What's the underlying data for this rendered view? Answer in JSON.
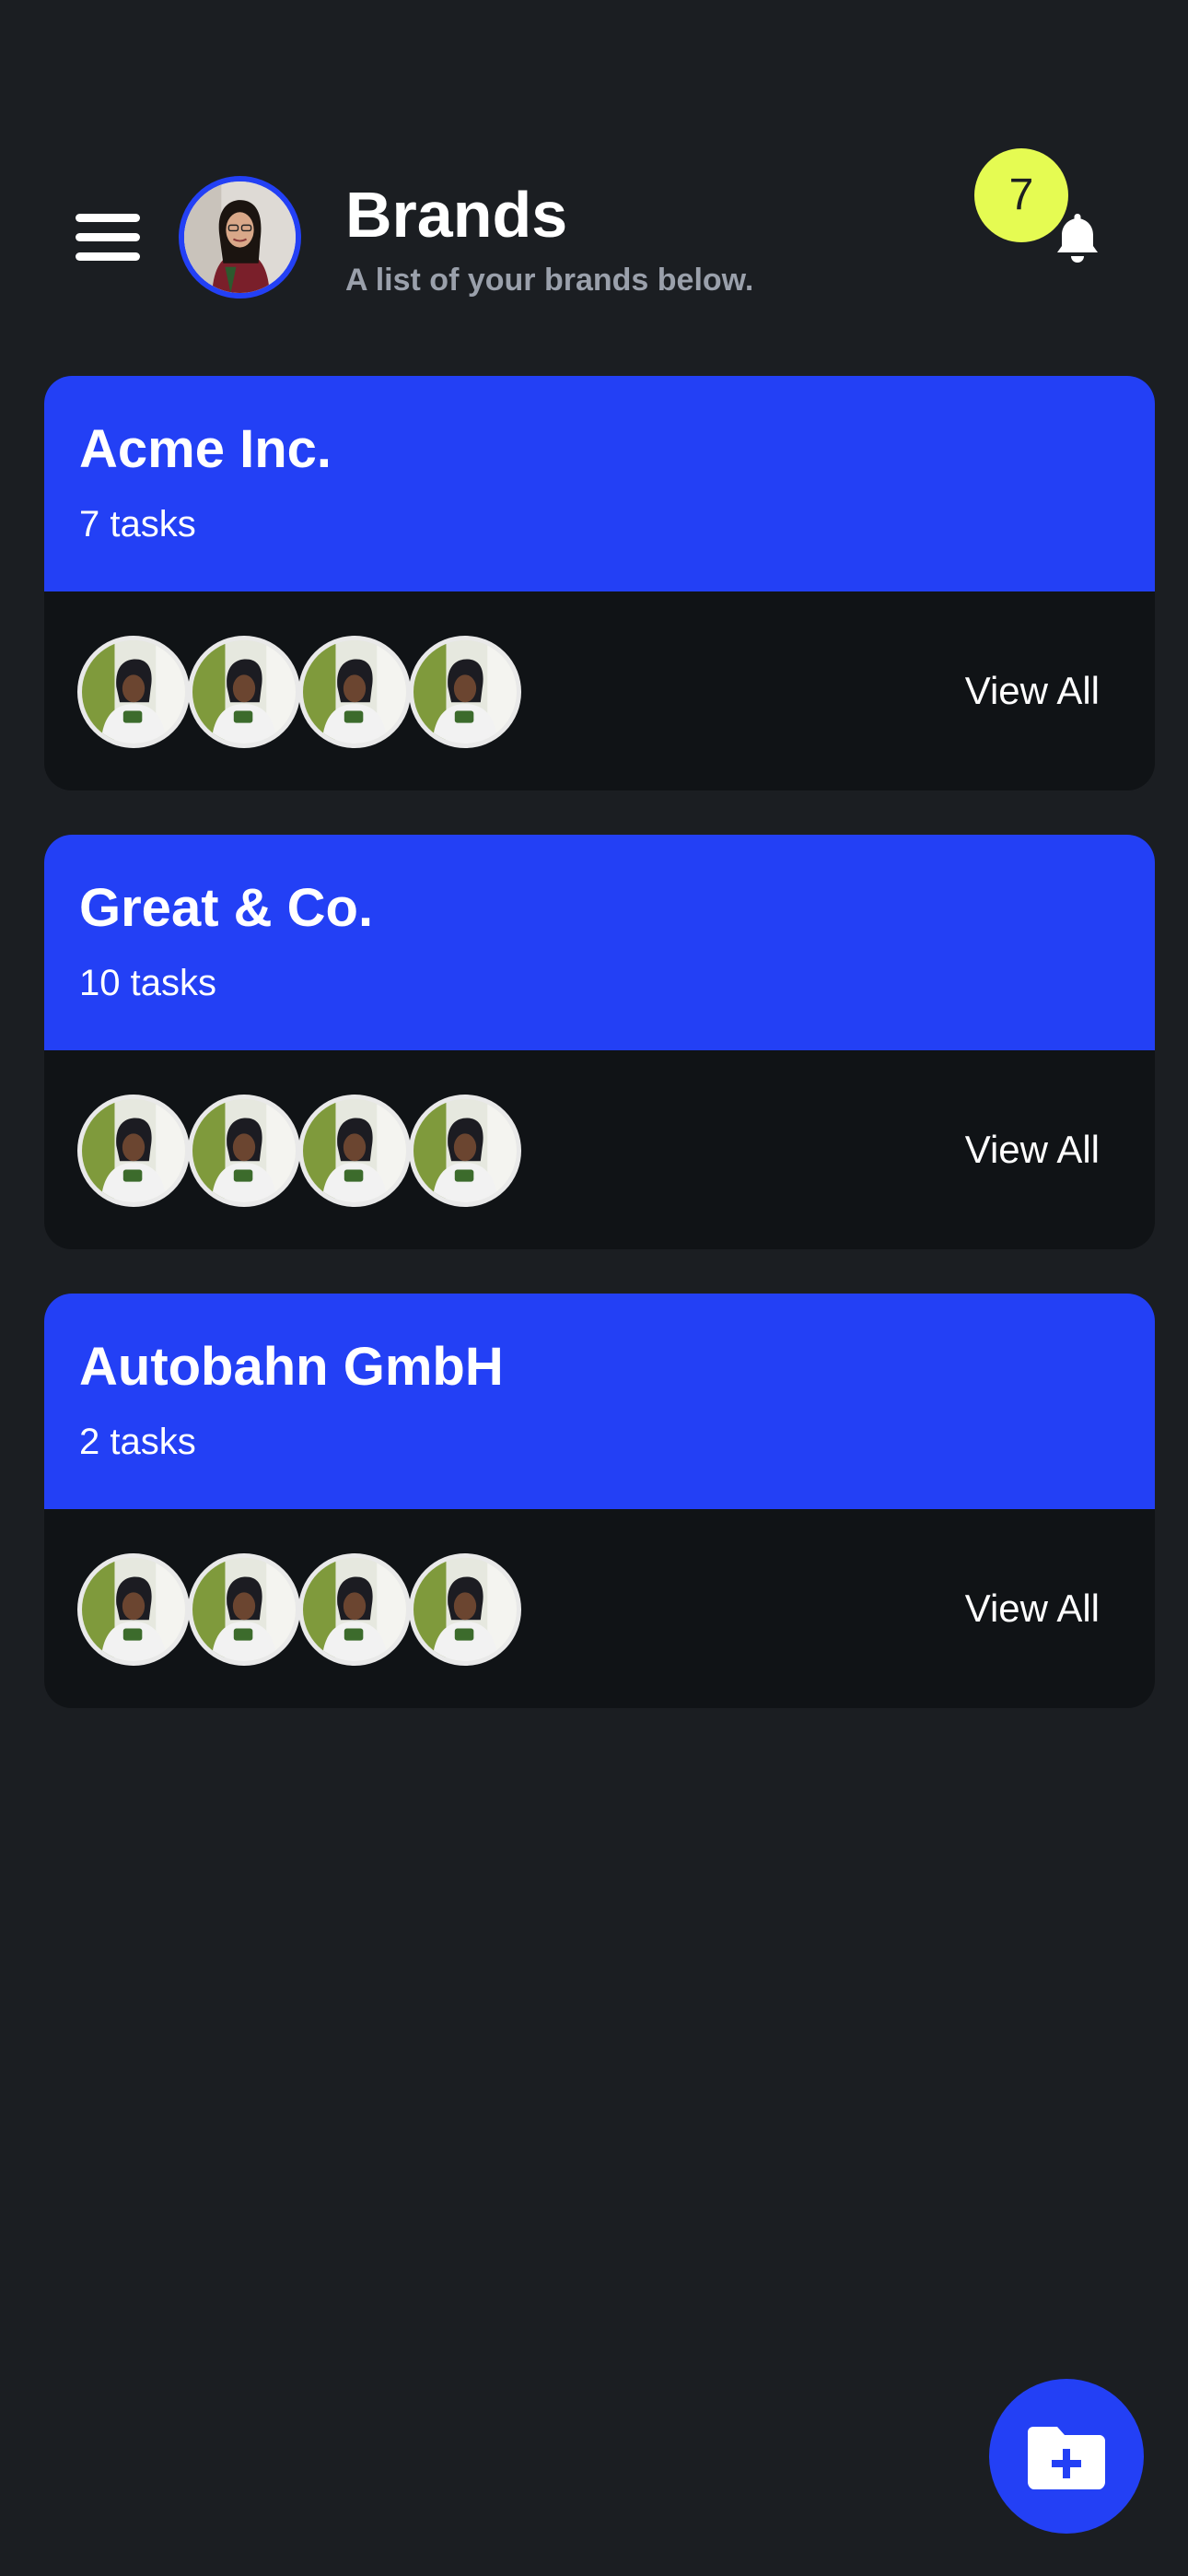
{
  "header": {
    "title": "Brands",
    "subtitle": "A list of your brands below.",
    "notification_count": "7",
    "icons": {
      "menu": "hamburger-menu-icon",
      "bell": "bell-icon"
    }
  },
  "brands": [
    {
      "name": "Acme Inc.",
      "tasks": "7 tasks",
      "view_all": "View All",
      "member_count": 4
    },
    {
      "name": "Great & Co.",
      "tasks": "10 tasks",
      "view_all": "View All",
      "member_count": 4
    },
    {
      "name": "Autobahn GmbH",
      "tasks": "2 tasks",
      "view_all": "View All",
      "member_count": 4
    }
  ],
  "fab": {
    "icon": "folder-add-icon"
  },
  "colors": {
    "background": "#1b1e22",
    "accent": "#2340f5",
    "badge": "#e5fb52",
    "card_footer": "#101316",
    "subtitle": "#9aa0ab"
  }
}
